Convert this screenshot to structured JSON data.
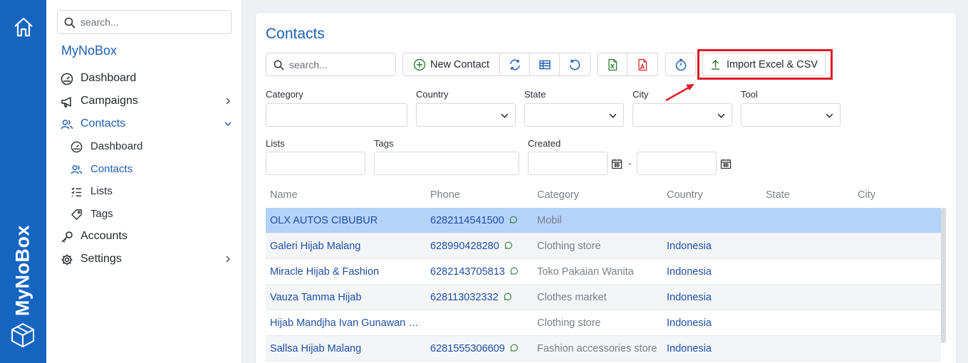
{
  "rail": {
    "brand": "MyNoBox"
  },
  "sidebar": {
    "search_placeholder": "search...",
    "brand": "MyNoBox",
    "items": [
      {
        "label": "Dashboard",
        "icon": "gauge-icon"
      },
      {
        "label": "Campaigns",
        "icon": "megaphone-icon"
      },
      {
        "label": "Contacts",
        "icon": "users-icon"
      },
      {
        "label": "Accounts",
        "icon": "key-icon"
      },
      {
        "label": "Settings",
        "icon": "gear-icon"
      }
    ],
    "contacts_sub": [
      {
        "label": "Dashboard",
        "icon": "gauge-icon"
      },
      {
        "label": "Contacts",
        "icon": "users-icon"
      },
      {
        "label": "Lists",
        "icon": "list-icon"
      },
      {
        "label": "Tags",
        "icon": "tag-icon"
      }
    ]
  },
  "main": {
    "title": "Contacts",
    "search_placeholder": "search...",
    "new_contact_label": "New Contact",
    "import_label": "Import Excel & CSV"
  },
  "filters": {
    "category": "Category",
    "country": "Country",
    "state": "State",
    "city": "City",
    "tool": "Tool",
    "lists": "Lists",
    "tags": "Tags",
    "created": "Created",
    "range_sep": "-"
  },
  "table": {
    "columns": [
      "Name",
      "Phone",
      "Category",
      "Country",
      "State",
      "City"
    ],
    "rows": [
      {
        "name": "OLX AUTOS CIBUBUR",
        "phone": "6282114541500",
        "category": "Mobil",
        "country": ""
      },
      {
        "name": "Galeri Hijab Malang",
        "phone": "628990428280",
        "category": "Clothing store",
        "country": "Indonesia"
      },
      {
        "name": "Miracle Hijab & Fashion",
        "phone": "6282143705813",
        "category": "Toko Pakaian Wanita",
        "country": "Indonesia"
      },
      {
        "name": "Vauza Tamma Hijab",
        "phone": "628113032332",
        "category": "Clothes market",
        "country": "Indonesia"
      },
      {
        "name": "Hijab Mandjha Ivan Gunawan Malang",
        "phone": "",
        "category": "Clothing store",
        "country": "Indonesia"
      },
      {
        "name": "Sallsa Hijab Malang",
        "phone": "6281555306609",
        "category": "Fashion accessories store",
        "country": "Indonesia"
      }
    ]
  },
  "colors": {
    "brand_blue": "#1565c0",
    "accent_blue": "#1e5fb3",
    "highlight_red": "#e01b24",
    "selected_row": "#b5d2fb"
  }
}
